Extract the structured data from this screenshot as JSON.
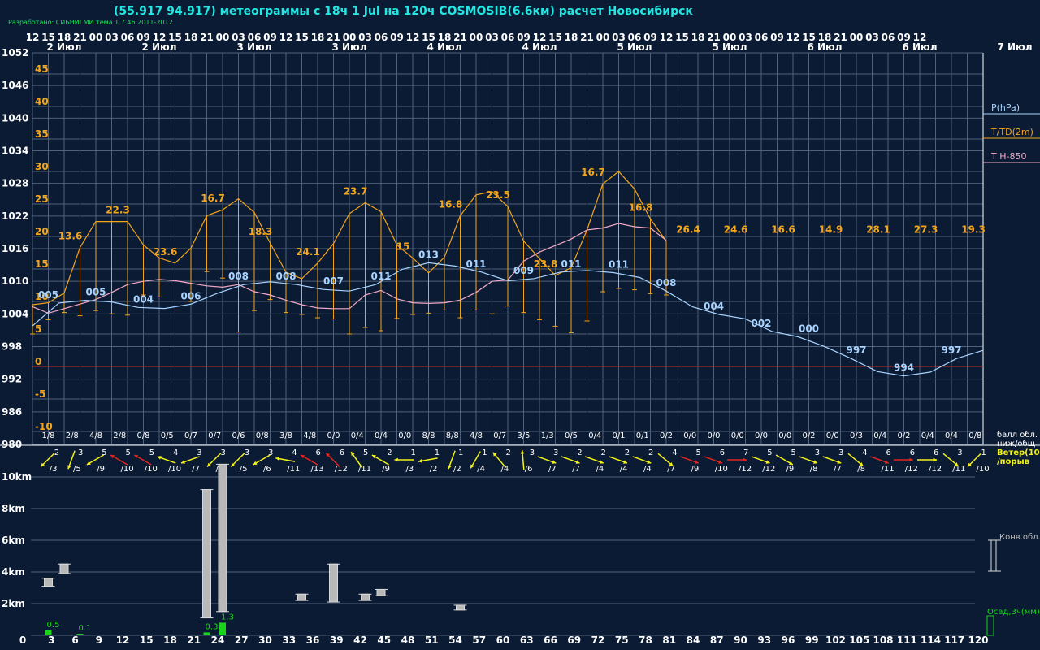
{
  "header": {
    "title": "(55.917 94.917) метеограммы с  18ч 1 Jul на 120ч COSMOSIB(6.6км) расчет Новосибирск",
    "credit": "Разработано: СИБНИГМИ тема 1.7.46 2011-2012"
  },
  "colors": {
    "background": "#0b1b33",
    "grid": "#4f607a",
    "pressure": "#a8d4ff",
    "temperature": "#f3a51b",
    "t850": "#f2a9c6",
    "zero_line": "#cc2a2a",
    "wind_normal": "#f2f21a",
    "wind_strong": "#e1251f",
    "cloud": "#b8b8b8",
    "precip": "#19d419"
  },
  "icons": {
    "wind": "wind-arrow-icon",
    "cloud": "cloud-bar-icon",
    "precip": "precip-bar-icon"
  },
  "chart_data": {
    "type": "line",
    "hour_labels": [
      "12",
      "15",
      "18",
      "21",
      "00",
      "03",
      "06",
      "09",
      "12",
      "15",
      "18",
      "21",
      "00",
      "03",
      "06",
      "09",
      "12",
      "15",
      "18",
      "21",
      "00",
      "03",
      "06",
      "09",
      "12",
      "15",
      "18",
      "21",
      "00",
      "03",
      "06",
      "09",
      "12",
      "15",
      "18",
      "21",
      "00",
      "03",
      "06",
      "09",
      "12",
      "15",
      "18",
      "21",
      "00",
      "03",
      "06",
      "09",
      "12",
      "15",
      "18",
      "21",
      "00",
      "03",
      "06",
      "09",
      "12"
    ],
    "date_labels": [
      "2 Июл",
      "2 Июл",
      "3 Июл",
      "3 Июл",
      "4 Июл",
      "4 Июл",
      "5 Июл",
      "5 Июл",
      "6 Июл",
      "6 Июл",
      "7 Июл"
    ],
    "pressure_ticks": [
      "1052",
      "1046",
      "1040",
      "1034",
      "1028",
      "1022",
      "1016",
      "1010",
      "1004",
      "998",
      "992",
      "986",
      "980"
    ],
    "temp_ticks": [
      "45",
      "40",
      "35",
      "30",
      "25",
      "20",
      "15",
      "10",
      "5",
      "0",
      "-5",
      "-10"
    ],
    "legend": [
      "P(hPa)",
      "T/TD(2m)",
      "T H-850"
    ],
    "lead_hours": [
      "0",
      "3",
      "6",
      "9",
      "12",
      "15",
      "18",
      "21",
      "24",
      "27",
      "30",
      "33",
      "36",
      "39",
      "42",
      "45",
      "48",
      "51",
      "54",
      "57",
      "60",
      "63",
      "66",
      "69",
      "72",
      "75",
      "78",
      "81",
      "84",
      "87",
      "90",
      "93",
      "96",
      "99",
      "102",
      "105",
      "108",
      "111",
      "114",
      "117",
      "120"
    ],
    "pressure": [
      1001.8,
      1006,
      1006.5,
      1006.2,
      1005.2,
      1005,
      1005.8,
      1007.8,
      1009.4,
      1009.9,
      1009.4,
      1008.5,
      1008.2,
      1009.4,
      1012.2,
      1013.4,
      1012.8,
      1011.7,
      1010.1,
      1010.5,
      1011.7,
      1012,
      1011.6,
      1010.7,
      1008.2,
      1005.3,
      1003.9,
      1003.1,
      1000.8,
      999.8,
      998,
      995.8,
      993.4,
      992.6,
      993.3,
      995.8,
      997.3
    ],
    "temperature": [
      9.5,
      9.8,
      11.3,
      18.3,
      22.3,
      22.3,
      22.3,
      18.7,
      16.7,
      15.9,
      18.2,
      23.2,
      24.1,
      25.8,
      23.7,
      19,
      14.5,
      13.5,
      15.9,
      18.9,
      23.5,
      25.2,
      23.8,
      18.7,
      16.7,
      14.4,
      16.8,
      23.2,
      26.4,
      26.9,
      24.6,
      19.3,
      16.6,
      14,
      15.2,
      21,
      28.1,
      30,
      27.3,
      22.7,
      19.3
    ],
    "dewpoint": [
      5,
      7.2,
      8.3,
      7.8,
      8.6,
      8.1,
      7.9,
      11,
      10.7,
      9.3,
      10,
      14.6,
      13.6,
      5.3,
      8.6,
      10.3,
      8.3,
      8,
      7.5,
      7.3,
      5,
      6,
      5.5,
      7.4,
      8,
      8.2,
      8.7,
      7.5,
      8.7,
      8.1,
      9.3,
      8.3,
      7.2,
      6.2,
      5.2,
      7,
      11.5,
      12,
      11.8,
      11.2,
      11
    ],
    "t850": [
      9.2,
      8.2,
      8.9,
      9.6,
      10.3,
      11.4,
      12.6,
      13.1,
      13.4,
      13.2,
      12.8,
      12.4,
      12.2,
      12.6,
      11.5,
      11,
      10.2,
      9.5,
      9,
      8.9,
      8.9,
      11,
      11.7,
      10.4,
      9.8,
      9.7,
      9.8,
      10.2,
      11.4,
      13.1,
      13.3,
      16.2,
      17.6,
      18.6,
      19.6,
      21,
      21.3,
      22,
      21.5,
      21.3,
      19.4
    ],
    "pressure_labels": [
      {
        "h": 3,
        "text": "005"
      },
      {
        "h": 12,
        "text": "005"
      },
      {
        "h": 21,
        "text": "004"
      },
      {
        "h": 30,
        "text": "006"
      },
      {
        "h": 39,
        "text": "008"
      },
      {
        "h": 48,
        "text": "008"
      },
      {
        "h": 57,
        "text": "007"
      },
      {
        "h": 66,
        "text": "011"
      },
      {
        "h": 75,
        "text": "013"
      },
      {
        "h": 84,
        "text": "011"
      },
      {
        "h": 93,
        "text": "009"
      },
      {
        "h": 102,
        "text": "011"
      },
      {
        "h": 111,
        "text": "011"
      },
      {
        "h": 120,
        "text": "008"
      },
      {
        "h": 129,
        "text": "004"
      },
      {
        "h": 138,
        "text": "002"
      },
      {
        "h": 147,
        "text": "000"
      },
      {
        "h": 156,
        "text": "997"
      },
      {
        "h": 165,
        "text": "994"
      },
      {
        "h": 174,
        "text": "997"
      }
    ],
    "temp_labels": [
      {
        "h": 9,
        "text": "13.6"
      },
      {
        "h": 18,
        "text": "22.3"
      },
      {
        "h": 27,
        "text": "23.6"
      },
      {
        "h": 36,
        "text": "16.7"
      },
      {
        "h": 45,
        "text": "18.3"
      },
      {
        "h": 54,
        "text": "24.1"
      },
      {
        "h": 63,
        "text": "23.7"
      },
      {
        "h": 72,
        "text": "15"
      },
      {
        "h": 81,
        "text": "16.8"
      },
      {
        "h": 90,
        "text": "23.5"
      },
      {
        "h": 99,
        "text": "23.8"
      },
      {
        "h": 108,
        "text": "16.7"
      },
      {
        "h": 117,
        "text": "16.8"
      },
      {
        "h": 126,
        "text": "26.4"
      },
      {
        "h": 135,
        "text": "24.6"
      },
      {
        "h": 144,
        "text": "16.6"
      },
      {
        "h": 153,
        "text": "14.9"
      },
      {
        "h": 162,
        "text": "28.1"
      },
      {
        "h": 171,
        "text": "27.3"
      },
      {
        "h": 180,
        "text": "19.3"
      }
    ],
    "cloud_cover": [
      "1/8",
      "2/8",
      "4/8",
      "2/8",
      "0/8",
      "0/5",
      "0/7",
      "0/7",
      "0/6",
      "0/8",
      "3/8",
      "4/8",
      "0/0",
      "0/4",
      "0/4",
      "0/0",
      "8/8",
      "8/8",
      "4/8",
      "0/7",
      "3/5",
      "1/3",
      "0/5",
      "0/4",
      "0/1",
      "0/1",
      "0/2",
      "0/0",
      "0/0",
      "0/0",
      "0/0",
      "0/0",
      "0/2",
      "0/0",
      "0/3",
      "0/4",
      "0/2",
      "0/4",
      "0/4",
      "0/8"
    ],
    "cloud_legend": [
      "балл обл.",
      "ниж/общ"
    ],
    "wind_legend": [
      "Ветер(10м)",
      "/порыв"
    ],
    "wind": [
      {
        "s": "2",
        "g": "/3",
        "d": 225,
        "r": false
      },
      {
        "s": "3",
        "g": "/5",
        "d": 200,
        "r": false
      },
      {
        "s": "5",
        "g": "/9",
        "d": 240,
        "r": false
      },
      {
        "s": "5",
        "g": "/10",
        "d": 300,
        "r": true
      },
      {
        "s": "5",
        "g": "/10",
        "d": 300,
        "r": true
      },
      {
        "s": "4",
        "g": "/10",
        "d": 290,
        "r": false
      },
      {
        "s": "3",
        "g": "/7",
        "d": 250,
        "r": false
      },
      {
        "s": "3",
        "g": "/5",
        "d": 225,
        "r": false
      },
      {
        "s": "3",
        "g": "/5",
        "d": 225,
        "r": false
      },
      {
        "s": "3",
        "g": "/6",
        "d": 240,
        "r": false
      },
      {
        "s": "4",
        "g": "/11",
        "d": 280,
        "r": false
      },
      {
        "s": "6",
        "g": "/13",
        "d": 300,
        "r": true
      },
      {
        "s": "6",
        "g": "/12",
        "d": 315,
        "r": true
      },
      {
        "s": "5",
        "g": "/11",
        "d": 325,
        "r": false
      },
      {
        "s": "2",
        "g": "/9",
        "d": 300,
        "r": false
      },
      {
        "s": "1",
        "g": "/3",
        "d": 270,
        "r": false
      },
      {
        "s": "1",
        "g": "/2",
        "d": 260,
        "r": false
      },
      {
        "s": "1",
        "g": "/2",
        "d": 200,
        "r": false
      },
      {
        "s": "1",
        "g": "/4",
        "d": 210,
        "r": false
      },
      {
        "s": "2",
        "g": "/4",
        "d": 320,
        "r": false
      },
      {
        "s": "3",
        "g": "/6",
        "d": 355,
        "r": false
      },
      {
        "s": "3",
        "g": "/7",
        "d": 110,
        "r": false
      },
      {
        "s": "2",
        "g": "/7",
        "d": 110,
        "r": false
      },
      {
        "s": "2",
        "g": "/4",
        "d": 110,
        "r": false
      },
      {
        "s": "2",
        "g": "/4",
        "d": 110,
        "r": false
      },
      {
        "s": "2",
        "g": "/4",
        "d": 110,
        "r": false
      },
      {
        "s": "4",
        "g": "/7",
        "d": 130,
        "r": false
      },
      {
        "s": "5",
        "g": "/9",
        "d": 110,
        "r": true
      },
      {
        "s": "6",
        "g": "/10",
        "d": 110,
        "r": true
      },
      {
        "s": "7",
        "g": "/12",
        "d": 90,
        "r": true
      },
      {
        "s": "5",
        "g": "/12",
        "d": 110,
        "r": false
      },
      {
        "s": "5",
        "g": "/9",
        "d": 120,
        "r": false
      },
      {
        "s": "3",
        "g": "/8",
        "d": 110,
        "r": false
      },
      {
        "s": "3",
        "g": "/7",
        "d": 110,
        "r": false
      },
      {
        "s": "4",
        "g": "/8",
        "d": 130,
        "r": false
      },
      {
        "s": "6",
        "g": "/11",
        "d": 110,
        "r": true
      },
      {
        "s": "6",
        "g": "/12",
        "d": 90,
        "r": true
      },
      {
        "s": "6",
        "g": "/12",
        "d": 90,
        "r": false
      },
      {
        "s": "3",
        "g": "/11",
        "d": 130,
        "r": false
      },
      {
        "s": "1",
        "g": "/10",
        "d": 225,
        "r": false
      }
    ],
    "height_ticks": [
      "10km",
      "8km",
      "6km",
      "4km",
      "2km"
    ],
    "convective_clouds": [
      {
        "h": 3,
        "base": 3.1,
        "top": 3.6
      },
      {
        "h": 6,
        "base": 3.9,
        "top": 4.5
      },
      {
        "h": 33,
        "base": 1.1,
        "top": 9.2
      },
      {
        "h": 36,
        "base": 1.5,
        "top": 10.8
      },
      {
        "h": 51,
        "base": 2.2,
        "top": 2.6
      },
      {
        "h": 57,
        "base": 2.1,
        "top": 4.5
      },
      {
        "h": 63,
        "base": 2.2,
        "top": 2.6
      },
      {
        "h": 66,
        "base": 2.5,
        "top": 2.9
      },
      {
        "h": 81,
        "base": 1.6,
        "top": 1.9
      }
    ],
    "precip": [
      {
        "h": 3,
        "v": 0.5,
        "label": "0.5"
      },
      {
        "h": 9,
        "v": 0.1,
        "label": "0.1"
      },
      {
        "h": 33,
        "v": 0.3,
        "label": "0.3"
      },
      {
        "h": 36,
        "v": 1.3,
        "label": "1.3"
      }
    ],
    "cloud_type_legend": "Конв.обл.",
    "precip_legend": "Осад,3ч(мм)",
    "pressure_range": [
      980,
      1052
    ],
    "temp_range": [
      -10,
      45
    ],
    "height_range_km": [
      0,
      11
    ],
    "grid": true
  }
}
